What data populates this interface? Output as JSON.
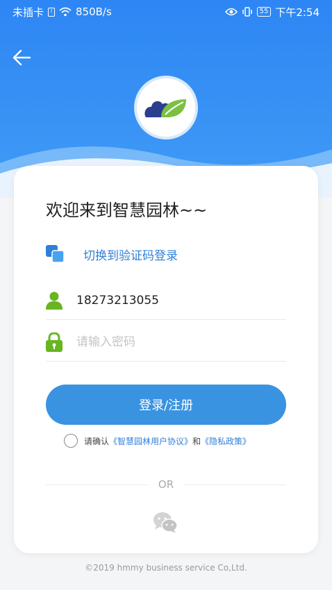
{
  "status_bar": {
    "carrier": "未插卡",
    "net_speed": "850B/s",
    "battery": "55",
    "time": "下午2:54"
  },
  "header": {
    "back_icon": "arrow-left-icon",
    "logo_icon": "cloud-leaf-logo"
  },
  "login": {
    "welcome": "欢迎来到智慧园林~~",
    "switch_label": "切换到验证码登录",
    "phone_value": "18273213055",
    "password_placeholder": "请输入密码",
    "login_button": "登录/注册",
    "agree_prefix": "请确认",
    "agreement_link": "《智慧园林用户协议》",
    "agree_and": "和",
    "privacy_link": "《隐私政策》",
    "or_text": "OR",
    "wechat_icon": "wechat-icon"
  },
  "footer": {
    "copyright": "©2019 hmmy business service Co,Ltd."
  },
  "colors": {
    "primary": "#2d86f4",
    "button": "#3a93e0",
    "link": "#2f7fd8",
    "icon_green": "#67b51f"
  }
}
